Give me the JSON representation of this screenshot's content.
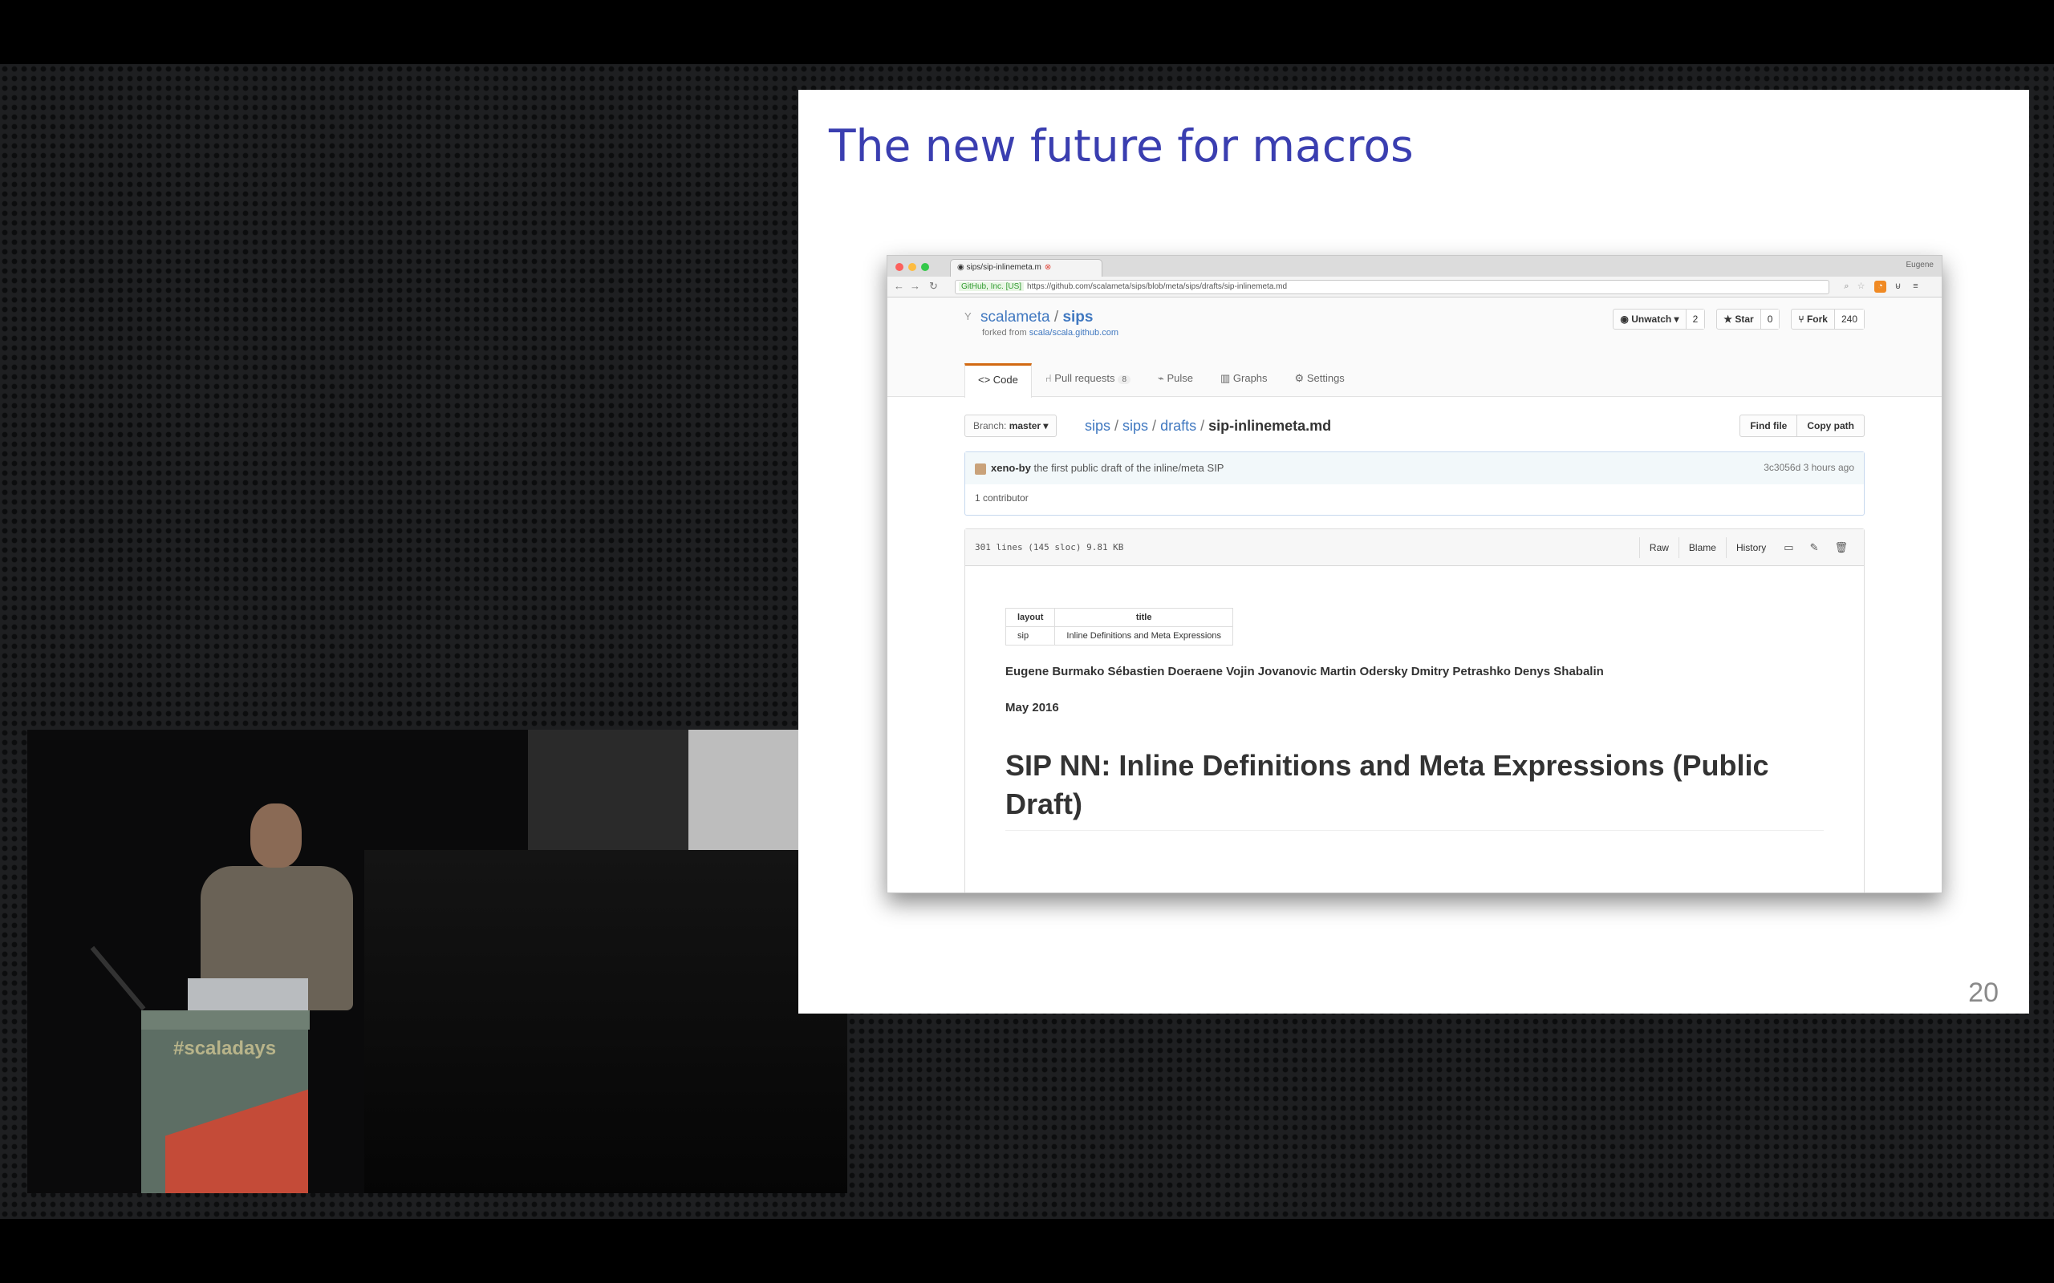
{
  "slide": {
    "title": "The new future for macros",
    "page_number": "20"
  },
  "video": {
    "lectern_text": "#scaladays"
  },
  "browser": {
    "tab_title": "sips/sip-inlinemeta.m",
    "profile": "Eugene",
    "url_badge": "GitHub, Inc. [US]",
    "url": "https://github.com/scalameta/sips/blob/meta/sips/drafts/sip-inlinemeta.md"
  },
  "repo": {
    "owner": "scalameta",
    "name": "sips",
    "forked_prefix": "forked from",
    "forked_from": "scala/scala.github.com",
    "actions": [
      {
        "label": "Unwatch ▾",
        "count": "2",
        "icon": "eye-icon"
      },
      {
        "label": "Star",
        "count": "0",
        "icon": "star-icon"
      },
      {
        "label": "Fork",
        "count": "240",
        "icon": "fork-icon"
      }
    ],
    "tabs": [
      {
        "label": "Code",
        "icon": "code-icon",
        "count": ""
      },
      {
        "label": "Pull requests",
        "icon": "pull-request-icon",
        "count": "8"
      },
      {
        "label": "Pulse",
        "icon": "pulse-icon",
        "count": ""
      },
      {
        "label": "Graphs",
        "icon": "graph-icon",
        "count": ""
      },
      {
        "label": "Settings",
        "icon": "gear-icon",
        "count": ""
      }
    ]
  },
  "file_nav": {
    "branch_prefix": "Branch:",
    "branch": "master ▾",
    "crumbs": [
      "sips",
      "sips",
      "drafts"
    ],
    "filename": "sip-inlinemeta.md",
    "find_file": "Find file",
    "copy_path": "Copy path"
  },
  "commit": {
    "author": "xeno-by",
    "message": "the first public draft of the inline/meta SIP",
    "sha_time": "3c3056d 3 hours ago",
    "contributors": "1 contributor"
  },
  "file": {
    "info": "301 lines (145 sloc)   9.81 KB",
    "raw": "Raw",
    "blame": "Blame",
    "history": "History"
  },
  "markdown": {
    "table_headers": [
      "layout",
      "title"
    ],
    "table_row": [
      "sip",
      "Inline Definitions and Meta Expressions"
    ],
    "authors": "Eugene Burmako Sébastien Doeraene Vojin Jovanovic Martin Odersky Dmitry Petrashko Denys Shabalin",
    "date": "May 2016",
    "heading": "SIP NN: Inline Definitions and Meta Expressions (Public Draft)"
  }
}
